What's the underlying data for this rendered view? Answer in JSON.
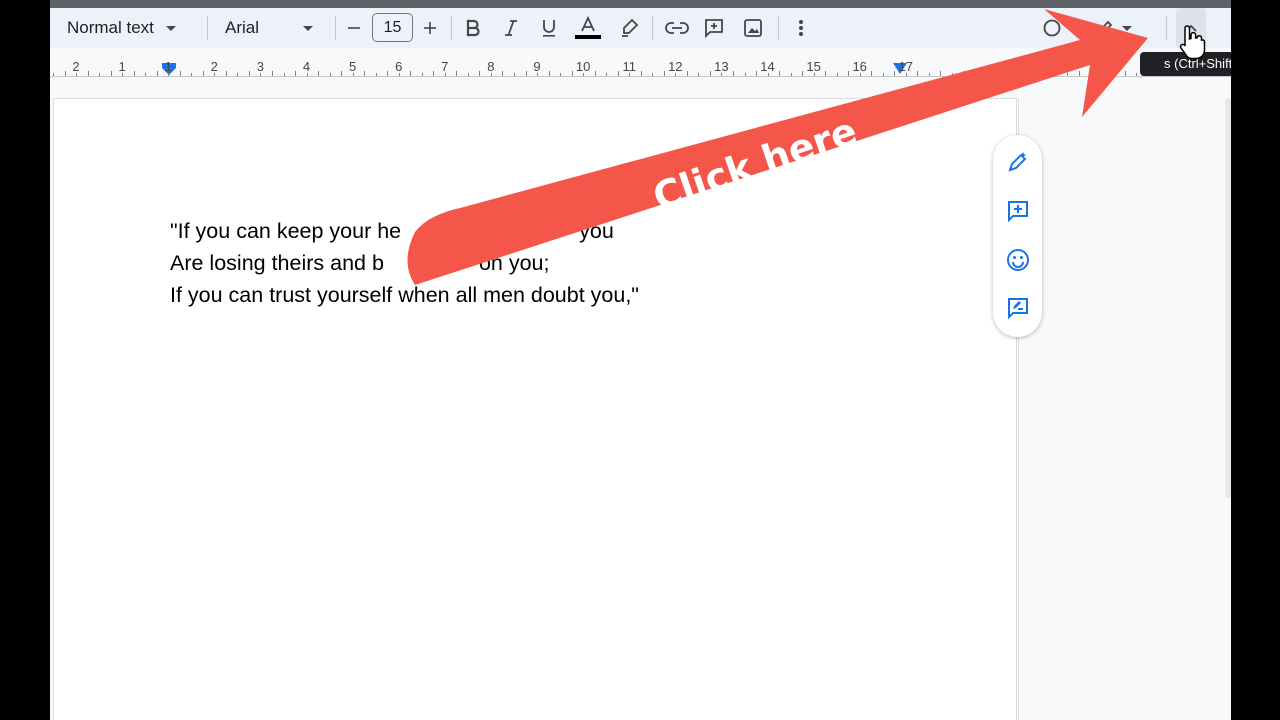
{
  "toolbar": {
    "style_value": "Normal text",
    "font_value": "Arial",
    "font_size": "15"
  },
  "ruler": {
    "numbers": [
      "2",
      "1",
      "1",
      "2",
      "3",
      "4",
      "5",
      "6",
      "7",
      "8",
      "9",
      "10",
      "11",
      "12",
      "13",
      "14",
      "15",
      "16",
      "17"
    ]
  },
  "document": {
    "lines": [
      "\"If you can keep your he",
      "you",
      "Are losing theirs and b",
      "on you;",
      "If you can trust yourself when all men doubt you,\""
    ]
  },
  "tooltip": {
    "text": "s (Ctrl+Shift+F)"
  },
  "annotation": {
    "label": "Click here",
    "color": "#f4574a"
  },
  "icons": {
    "ai_edit": "pencil-sparkle-icon",
    "add_comment": "add-comment-icon",
    "emoji": "emoji-icon",
    "suggest": "suggest-edit-icon"
  }
}
